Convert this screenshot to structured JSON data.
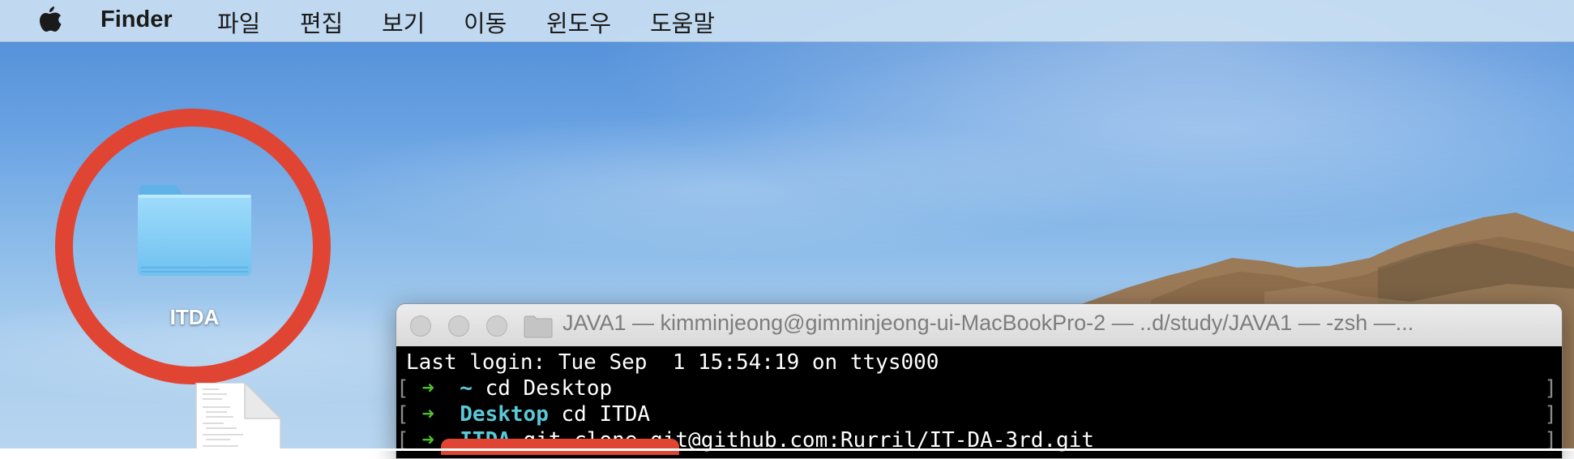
{
  "menubar": {
    "apple_icon": "apple-logo-icon",
    "app_name": "Finder",
    "items": [
      "파일",
      "편집",
      "보기",
      "이동",
      "윈도우",
      "도움말"
    ]
  },
  "desktop": {
    "folder": {
      "label": "ITDA",
      "icon": "folder-icon"
    },
    "document": {
      "icon": "document-icon"
    },
    "highlight_color": "#e04534"
  },
  "terminal": {
    "title": "JAVA1 — kimminjeong@gimminjeong-ui-MacBookPro-2 — ..d/study/JAVA1 — -zsh —...",
    "lines": [
      {
        "text": "Last login: Tue Sep  1 15:54:19 on ttys000"
      },
      {
        "bracket": "[",
        "arrow": "➜",
        "cwd": "~",
        "cmd": " cd Desktop",
        "end": "]"
      },
      {
        "bracket": "[",
        "arrow": "➜",
        "cwd": "Desktop",
        "cmd": " cd ITDA",
        "end": "]"
      },
      {
        "bracket": "[",
        "arrow": "➜",
        "cwd": "ITDA",
        "cmd": " git clone git@github.com:Rurril/IT-DA-3rd.git",
        "end": "]"
      }
    ],
    "colors": {
      "arrow": "#4fbf2c",
      "cwd": "#5ac8d8",
      "background": "#000000"
    }
  }
}
